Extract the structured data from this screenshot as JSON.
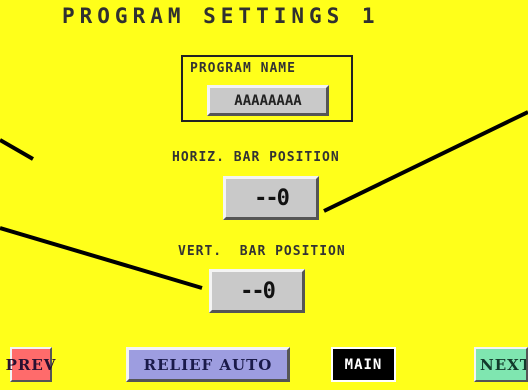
{
  "title": "PROGRAM SETTINGS 1",
  "program_name": {
    "label": "PROGRAM NAME",
    "value": "AAAAAAAA"
  },
  "horiz_bar": {
    "label": "HORIZ. BAR POSITION",
    "value": "--0"
  },
  "vert_bar": {
    "label": "VERT.  BAR POSITION",
    "value": "--0"
  },
  "nav": {
    "prev": "PREV",
    "relief_auto": "RELIEF AUTO",
    "main": "MAIN",
    "next": "NEXT"
  },
  "colors": {
    "background": "#ffff1a",
    "prev": "#ff6b6b",
    "relief_auto": "#9d9de0",
    "main": "#000000",
    "next": "#7fe6b0"
  }
}
